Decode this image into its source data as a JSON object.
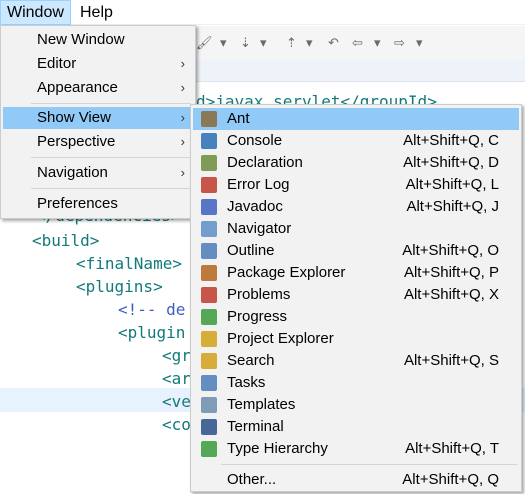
{
  "menubar": {
    "window": "Window",
    "help": "Help"
  },
  "window_menu": {
    "new_window": "New Window",
    "editor": "Editor",
    "appearance": "Appearance",
    "show_view": "Show View",
    "perspective": "Perspective",
    "navigation": "Navigation",
    "preferences": "Preferences"
  },
  "show_view_menu": {
    "items": [
      {
        "label": "Ant",
        "accel": "",
        "icon": "ant-icon",
        "color": "#8a6a3a"
      },
      {
        "label": "Console",
        "accel": "Alt+Shift+Q, C",
        "icon": "console-icon",
        "color": "#2a6fb5"
      },
      {
        "label": "Declaration",
        "accel": "Alt+Shift+Q, D",
        "icon": "declaration-icon",
        "color": "#6b8c3a"
      },
      {
        "label": "Error Log",
        "accel": "Alt+Shift+Q, L",
        "icon": "error-log-icon",
        "color": "#c0392b"
      },
      {
        "label": "Javadoc",
        "accel": "Alt+Shift+Q, J",
        "icon": "javadoc-icon",
        "color": "#3f5fbf"
      },
      {
        "label": "Navigator",
        "accel": "",
        "icon": "navigator-icon",
        "color": "#5a8fc7"
      },
      {
        "label": "Outline",
        "accel": "Alt+Shift+Q, O",
        "icon": "outline-icon",
        "color": "#4a7db8"
      },
      {
        "label": "Package Explorer",
        "accel": "Alt+Shift+Q, P",
        "icon": "package-explorer-icon",
        "color": "#b5651d"
      },
      {
        "label": "Problems",
        "accel": "Alt+Shift+Q, X",
        "icon": "problems-icon",
        "color": "#c0392b"
      },
      {
        "label": "Progress",
        "accel": "",
        "icon": "progress-icon",
        "color": "#3a9b3a"
      },
      {
        "label": "Project Explorer",
        "accel": "",
        "icon": "project-explorer-icon",
        "color": "#d4a017"
      },
      {
        "label": "Search",
        "accel": "Alt+Shift+Q, S",
        "icon": "search-icon",
        "color": "#d4a017"
      },
      {
        "label": "Tasks",
        "accel": "",
        "icon": "tasks-icon",
        "color": "#4a7db8"
      },
      {
        "label": "Templates",
        "accel": "",
        "icon": "templates-icon",
        "color": "#6b8cae"
      },
      {
        "label": "Terminal",
        "accel": "",
        "icon": "terminal-icon",
        "color": "#2a4f8a"
      },
      {
        "label": "Type Hierarchy",
        "accel": "Alt+Shift+Q, T",
        "icon": "type-hierarchy-icon",
        "color": "#3a9b3a"
      }
    ],
    "other": {
      "label": "Other...",
      "accel": "Alt+Shift+Q, Q"
    }
  },
  "editor": {
    "line_groupid": "d>javax.servlet</groupId>",
    "line_dependencies": "</dependencies>",
    "line_build": "<build>",
    "line_finalname": "<finalName>",
    "line_plugins": "<plugins>",
    "line_comment": "<!-- de",
    "line_plugin": "<plugin",
    "line_gr": "<gr",
    "line_ar": "<ar",
    "line_ve": "<ve",
    "line_co": "<co"
  }
}
